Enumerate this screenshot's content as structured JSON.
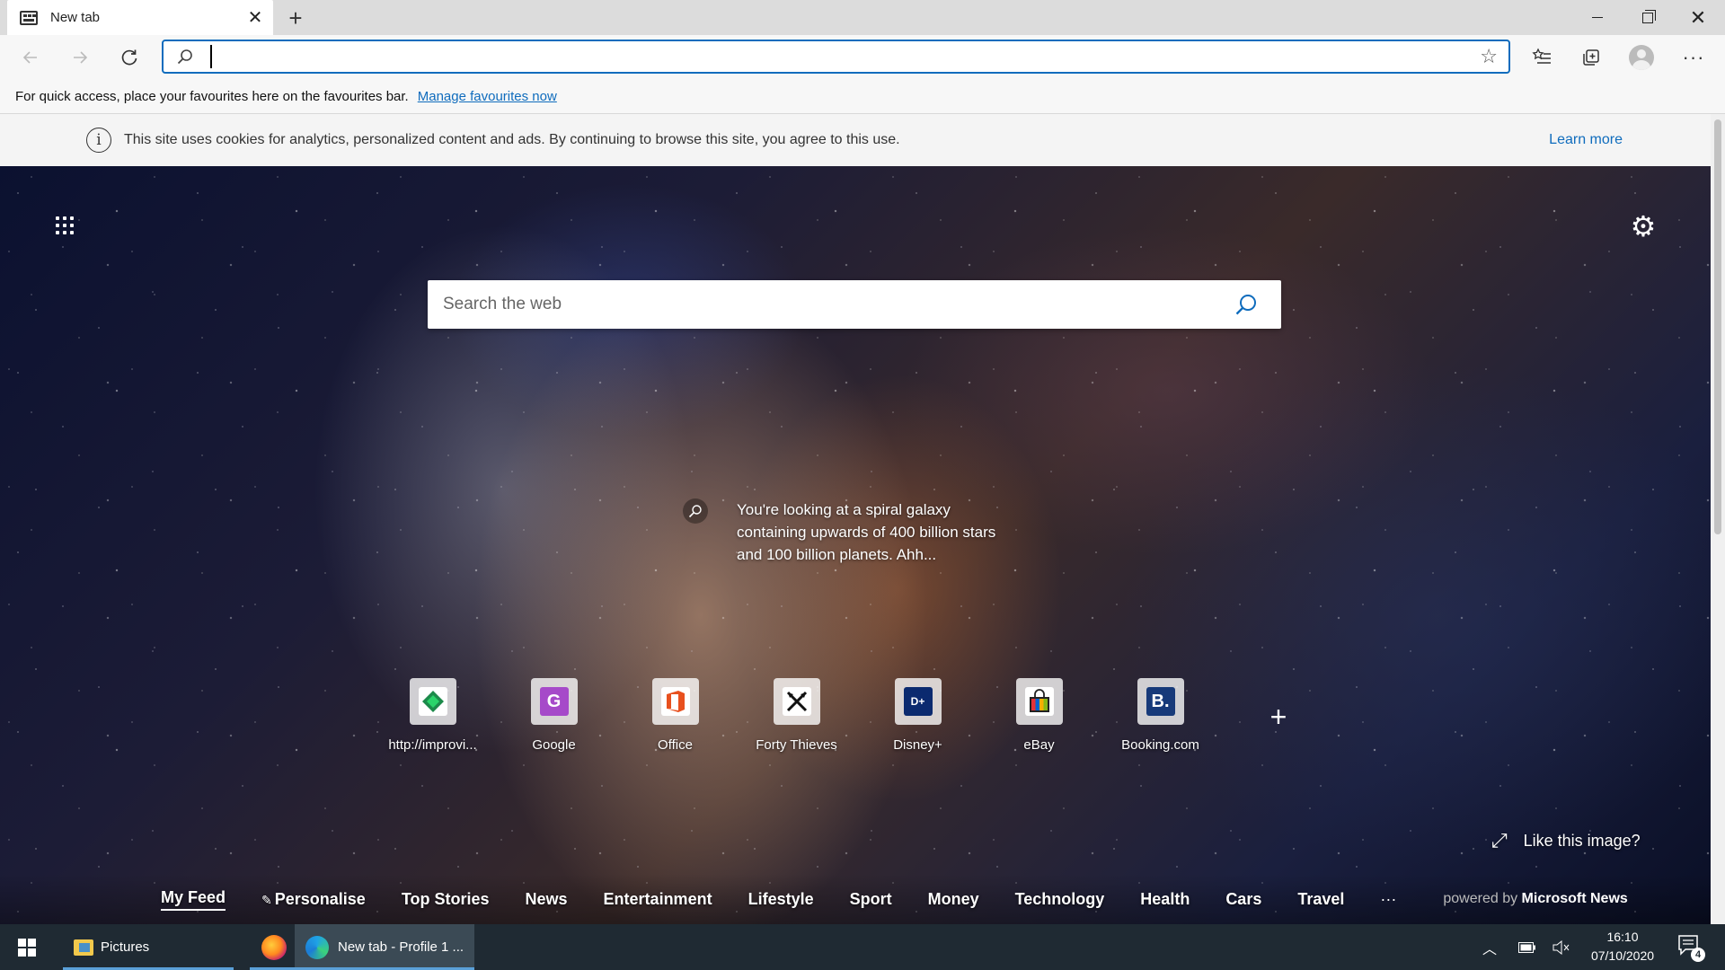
{
  "browser": {
    "tab": {
      "title": "New tab",
      "favicon": "newtab-grid-icon",
      "close_icon": "close-icon"
    },
    "new_tab_icon": "plus-icon",
    "window_controls": [
      "minimize-icon",
      "restore-icon",
      "close-icon"
    ],
    "toolbar": {
      "back_icon": "back-arrow-icon",
      "forward_icon": "forward-arrow-icon",
      "reload_icon": "refresh-icon",
      "address_value": "",
      "favourite_icon": "star-icon",
      "favourites_icon": "favourites-icon",
      "collections_icon": "collections-icon",
      "profile_icon": "avatar",
      "more_label": "···"
    },
    "favbar": {
      "text": "For quick access, place your favourites here on the favourites bar.",
      "link": "Manage favourites now"
    }
  },
  "cookie_banner": {
    "icon": "i",
    "text": "This site uses cookies for analytics, personalized content and ads. By continuing to browse this site, you agree to this use.",
    "learn_more": "Learn more"
  },
  "newtab": {
    "apps_icon": "apps-grid-icon",
    "settings_icon": "⚙",
    "search_placeholder": "Search the web",
    "image_caption": "You're looking at a spiral galaxy containing upwards of 400 billion stars and 100 billion planets. Ahh...",
    "tiles": [
      {
        "label": "http://improvi...",
        "icon": "improvi-icon",
        "color": "#2bb673",
        "glyph": "◆"
      },
      {
        "label": "Google",
        "icon": "google-icon",
        "color": "#a64ac9",
        "glyph": "G"
      },
      {
        "label": "Office",
        "icon": "office-icon",
        "color": "#e8501e",
        "glyph": "O"
      },
      {
        "label": "Forty Thieves",
        "icon": "forty-thieves-icon",
        "color": "#f5f5f5",
        "glyph": "⚔"
      },
      {
        "label": "Disney+",
        "icon": "disney-plus-icon",
        "color": "#0b2a6f",
        "glyph": "D+"
      },
      {
        "label": "eBay",
        "icon": "ebay-icon",
        "color": "#f1f1f1",
        "glyph": "🛍"
      },
      {
        "label": "Booking.com",
        "icon": "booking-icon",
        "color": "#173a7a",
        "glyph": "B."
      }
    ],
    "add_tile": "+",
    "like_image": "Like this image?",
    "feed_nav": {
      "items": [
        "My Feed",
        "Personalise",
        "Top Stories",
        "News",
        "Entertainment",
        "Lifestyle",
        "Sport",
        "Money",
        "Technology",
        "Health",
        "Cars",
        "Travel"
      ],
      "more": "···",
      "powered_by": "powered by",
      "brand": "Microsoft News"
    }
  },
  "taskbar": {
    "apps": [
      {
        "label": "Pictures",
        "icon": "folder-icon"
      },
      {
        "label": "",
        "icon": "firefox-icon"
      },
      {
        "label": "New tab - Profile 1 ...",
        "icon": "edge-icon"
      }
    ],
    "time": "16:10",
    "date": "07/10/2020",
    "notification_count": "4"
  },
  "colors": {
    "accent": "#0f6cbd",
    "taskbar": "#1f2a33",
    "chrome": "#f7f7f7"
  }
}
